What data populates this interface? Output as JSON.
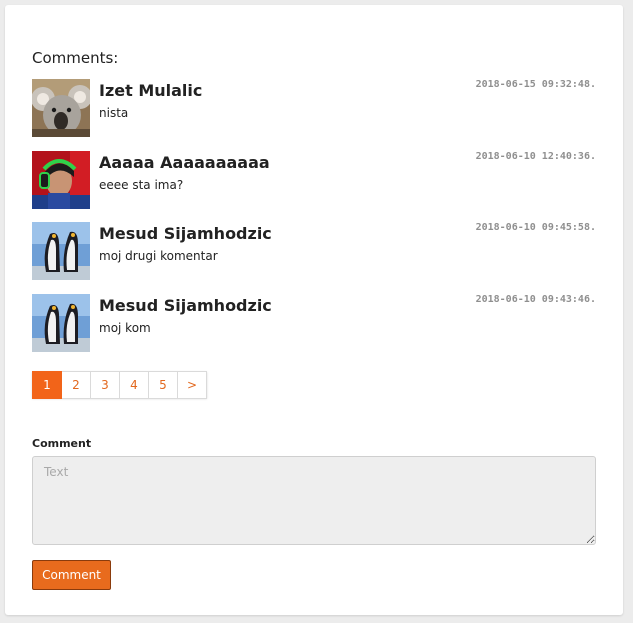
{
  "comments_section": {
    "heading": "Comments:",
    "comments": [
      {
        "author": "Izet Mulalic",
        "text": "nista",
        "date": "2018-06-15 09:32:48.",
        "avatar": "koala-avatar-icon"
      },
      {
        "author": "Aaaaa Aaaaaaaaaa",
        "text": "eeee sta ima?",
        "date": "2018-06-10 12:40:36.",
        "avatar": "headphones-person-avatar-icon"
      },
      {
        "author": "Mesud Sijamhodzic",
        "text": "moj drugi komentar",
        "date": "2018-06-10 09:45:58.",
        "avatar": "penguins-avatar-icon"
      },
      {
        "author": "Mesud Sijamhodzic",
        "text": "moj kom",
        "date": "2018-06-10 09:43:46.",
        "avatar": "penguins-avatar-icon"
      }
    ]
  },
  "pagination": {
    "pages": [
      "1",
      "2",
      "3",
      "4",
      "5"
    ],
    "active_page": "1",
    "next_label": ">"
  },
  "form": {
    "label": "Comment",
    "placeholder": "Text",
    "value": "",
    "submit_label": "Comment"
  },
  "colors": {
    "accent": "#f26419",
    "button": "#e86b1d",
    "date": "#8f8f8f"
  }
}
